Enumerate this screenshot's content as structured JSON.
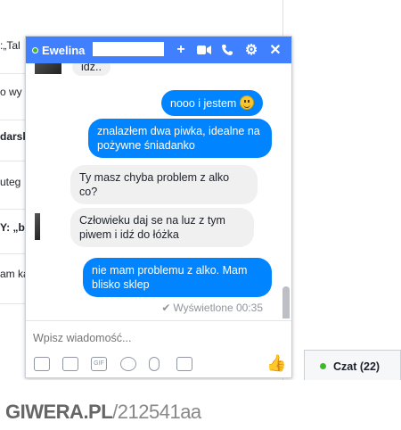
{
  "feed": {
    "snippets": [
      ":„Tal",
      "o wy",
      "darsk",
      "uteg",
      "Y: „b",
      "am ka"
    ]
  },
  "chat": {
    "contact_name": "Ewelina",
    "header_icons": [
      "plus-icon",
      "video-icon",
      "phone-icon",
      "gear-icon",
      "close-icon"
    ],
    "messages": [
      {
        "from": "in",
        "text": "idź.."
      },
      {
        "from": "out",
        "text": "nooo i jestem"
      },
      {
        "from": "out",
        "text": "znalazłem dwa piwka, idealne na pożywne śniadanko"
      },
      {
        "from": "in",
        "text": "Ty masz chyba problem z alko co?"
      },
      {
        "from": "in",
        "text": "Człowieku daj se na luz z tym piwem i idź do łóżka"
      },
      {
        "from": "out",
        "text": "nie mam problemu z alko. Mam blisko sklep"
      }
    ],
    "seen_status": "Wyświetlone 00:35",
    "composer_placeholder": "Wpisz wiadomość...",
    "toolbar_icons": [
      "photo-icon",
      "sticker-icon",
      "gif-icon",
      "emoji-icon",
      "attach-icon",
      "camera-icon",
      "like-icon"
    ],
    "accent_color": "#4080ff"
  },
  "chat_tab": {
    "label": "Czat (22)"
  },
  "watermark": {
    "site": "GIWERA.PL",
    "id": "/212541aa"
  }
}
